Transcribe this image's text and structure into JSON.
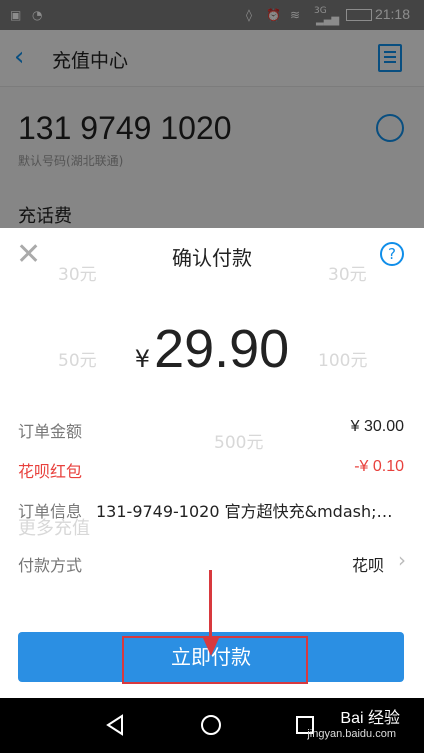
{
  "status_bar": {
    "network": "3G",
    "time": "21:18"
  },
  "background_page": {
    "title": "充值中心",
    "phone_number": "131 9749 1020",
    "phone_sub": "默认号码(湖北联通)",
    "section_title": "充话费",
    "faded_options": [
      "30元",
      "50元",
      "100元",
      "30元",
      "500元"
    ],
    "faded_more": "更多充值"
  },
  "sheet": {
    "title": "确认付款",
    "help_glyph": "?",
    "currency": "¥",
    "amount": "29.90",
    "rows": {
      "order_amount_label": "订单金额",
      "order_amount_value": "¥ 30.00",
      "huabei_label": "花呗红包",
      "huabei_value": "-¥ 0.10",
      "order_info_label": "订单信息",
      "order_info_value": "131-9749-1020 官方超快充&mdash;湖...",
      "payment_method_label": "付款方式",
      "payment_method_value": "花呗"
    },
    "pay_button": "立即付款"
  },
  "watermark": {
    "brand": "Bai 经验",
    "url": "jingyan.baidu.com"
  }
}
